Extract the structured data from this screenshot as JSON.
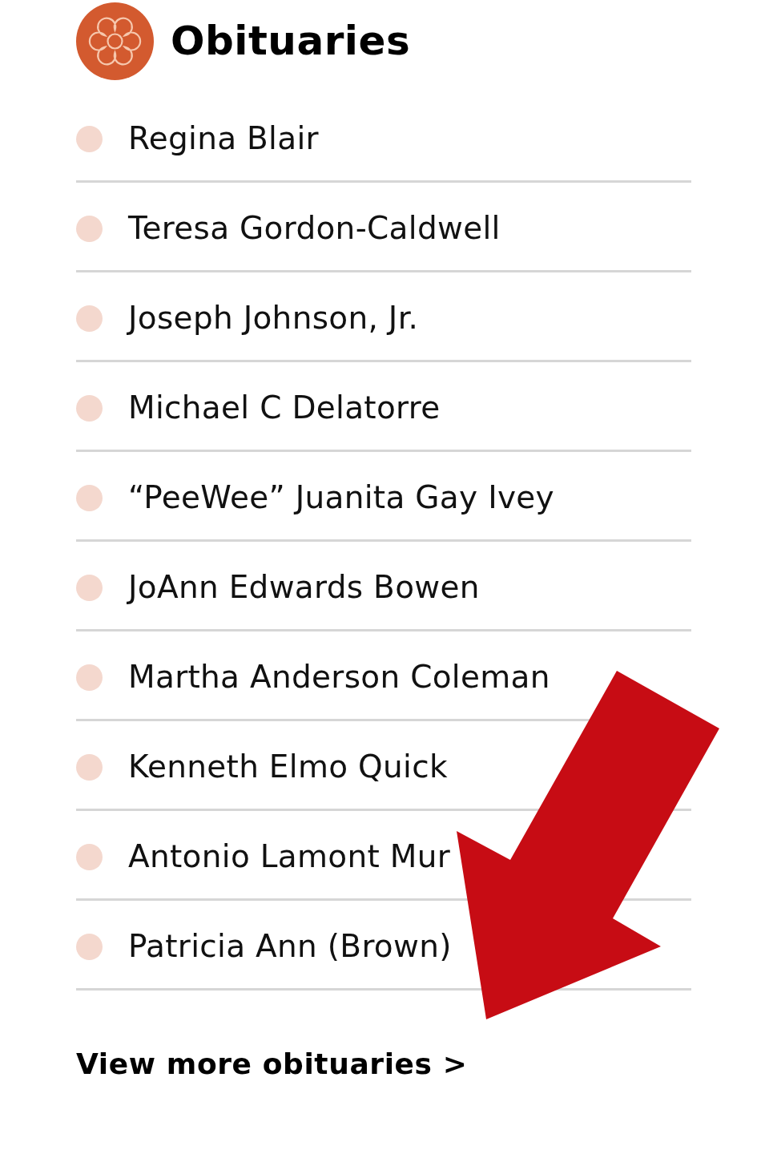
{
  "header": {
    "title": "Obituaries"
  },
  "obituaries": [
    {
      "name": "Regina Blair"
    },
    {
      "name": "Teresa Gordon-Caldwell"
    },
    {
      "name": "Joseph Johnson, Jr."
    },
    {
      "name": "Michael C Delatorre"
    },
    {
      "name": "“PeeWee” Juanita Gay Ivey"
    },
    {
      "name": "JoAnn Edwards Bowen"
    },
    {
      "name": "Martha Anderson Coleman"
    },
    {
      "name": "Kenneth Elmo Quick"
    },
    {
      "name": "Antonio Lamont Mur"
    },
    {
      "name": "Patricia Ann (Brown)"
    }
  ],
  "more_link": {
    "label": "View more obituaries >"
  }
}
